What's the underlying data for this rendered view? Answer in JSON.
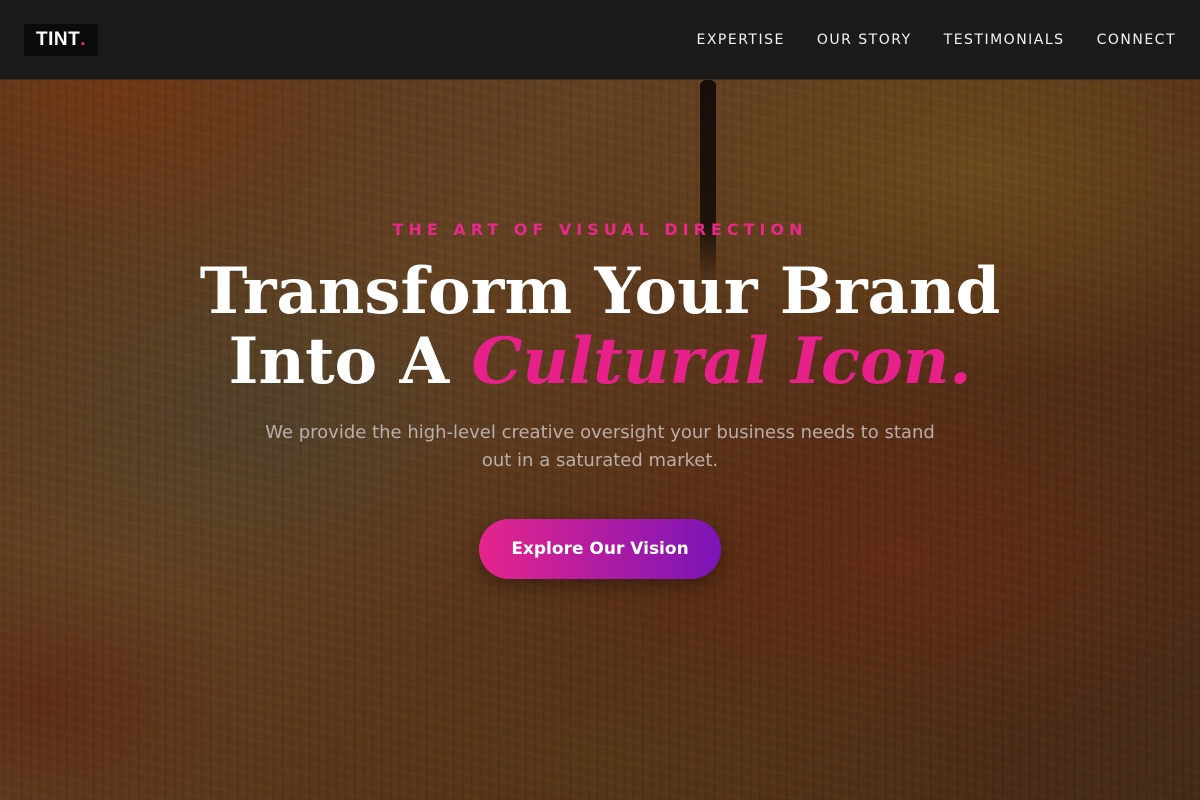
{
  "brand": {
    "logo_text": "TINT",
    "logo_dot": ".",
    "accent_color": "#e8208a",
    "gradient_start": "#e6258c",
    "gradient_end": "#7a14b8"
  },
  "nav": {
    "items": [
      {
        "label": "EXPERTISE"
      },
      {
        "label": "OUR STORY"
      },
      {
        "label": "TESTIMONIALS"
      },
      {
        "label": "CONNECT"
      }
    ]
  },
  "hero": {
    "eyebrow": "THE ART OF VISUAL DIRECTION",
    "headline_line1": "Transform Your Brand",
    "headline_line2_plain": "Into A",
    "headline_line2_accent": "Cultural Icon.",
    "subtext": "We provide the high-level creative oversight your business needs to stand out in a saturated market.",
    "cta_label": "Explore Our Vision"
  }
}
